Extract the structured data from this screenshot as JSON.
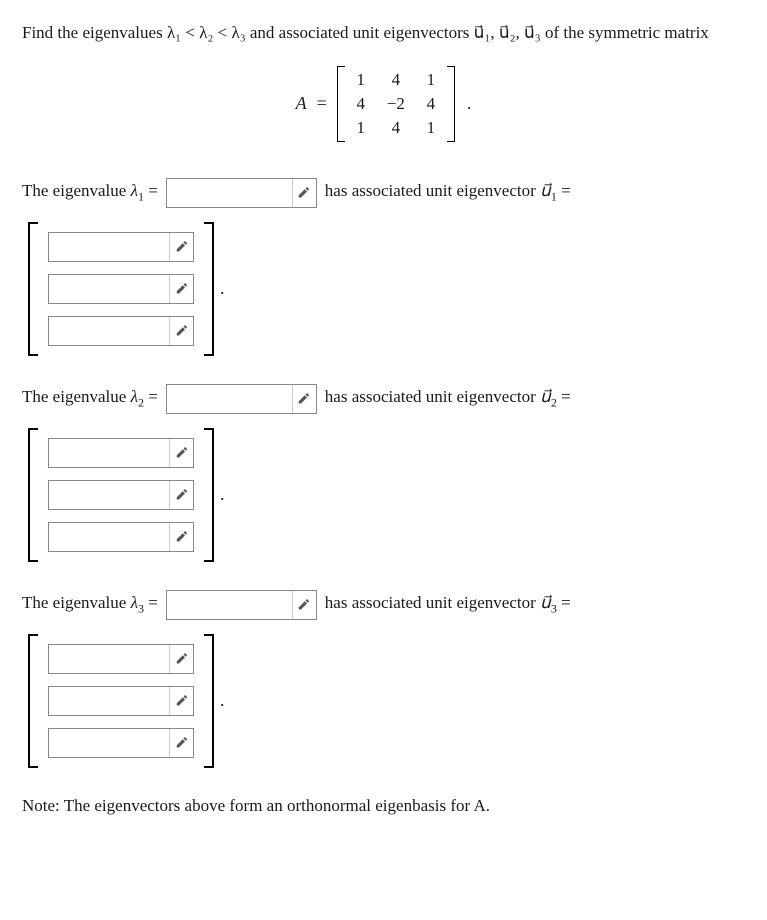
{
  "question": {
    "intro": "Find the eigenvalues λ₁ < λ₂ < λ₃ and associated unit eigenvectors u⃗₁, u⃗₂, u⃗₃ of the symmetric matrix"
  },
  "matrix": {
    "label": "A",
    "eq": "=",
    "r1c1": "1",
    "r1c2": "4",
    "r1c3": "1",
    "r2c1": "4",
    "r2c2": "−2",
    "r2c3": "4",
    "r3c1": "1",
    "r3c2": "4",
    "r3c3": "1",
    "period": "."
  },
  "parts": {
    "p1": {
      "label_pre": "The eigenvalue ",
      "lambda": "λ",
      "sub": "1",
      "eq": " = ",
      "label_post": "has associated unit eigenvector ",
      "uvec": "u⃗",
      "usub": "1",
      "ueq": " ="
    },
    "p2": {
      "label_pre": "The eigenvalue ",
      "lambda": "λ",
      "sub": "2",
      "eq": " = ",
      "label_post": "has associated unit eigenvector ",
      "uvec": "u⃗",
      "usub": "2",
      "ueq": " ="
    },
    "p3": {
      "label_pre": "The eigenvalue ",
      "lambda": "λ",
      "sub": "3",
      "eq": " = ",
      "label_post": "has associated unit eigenvector ",
      "uvec": "u⃗",
      "usub": "3",
      "ueq": " ="
    }
  },
  "vector_period": ".",
  "note": "Note: The eigenvectors above form an orthonormal eigenbasis for A."
}
